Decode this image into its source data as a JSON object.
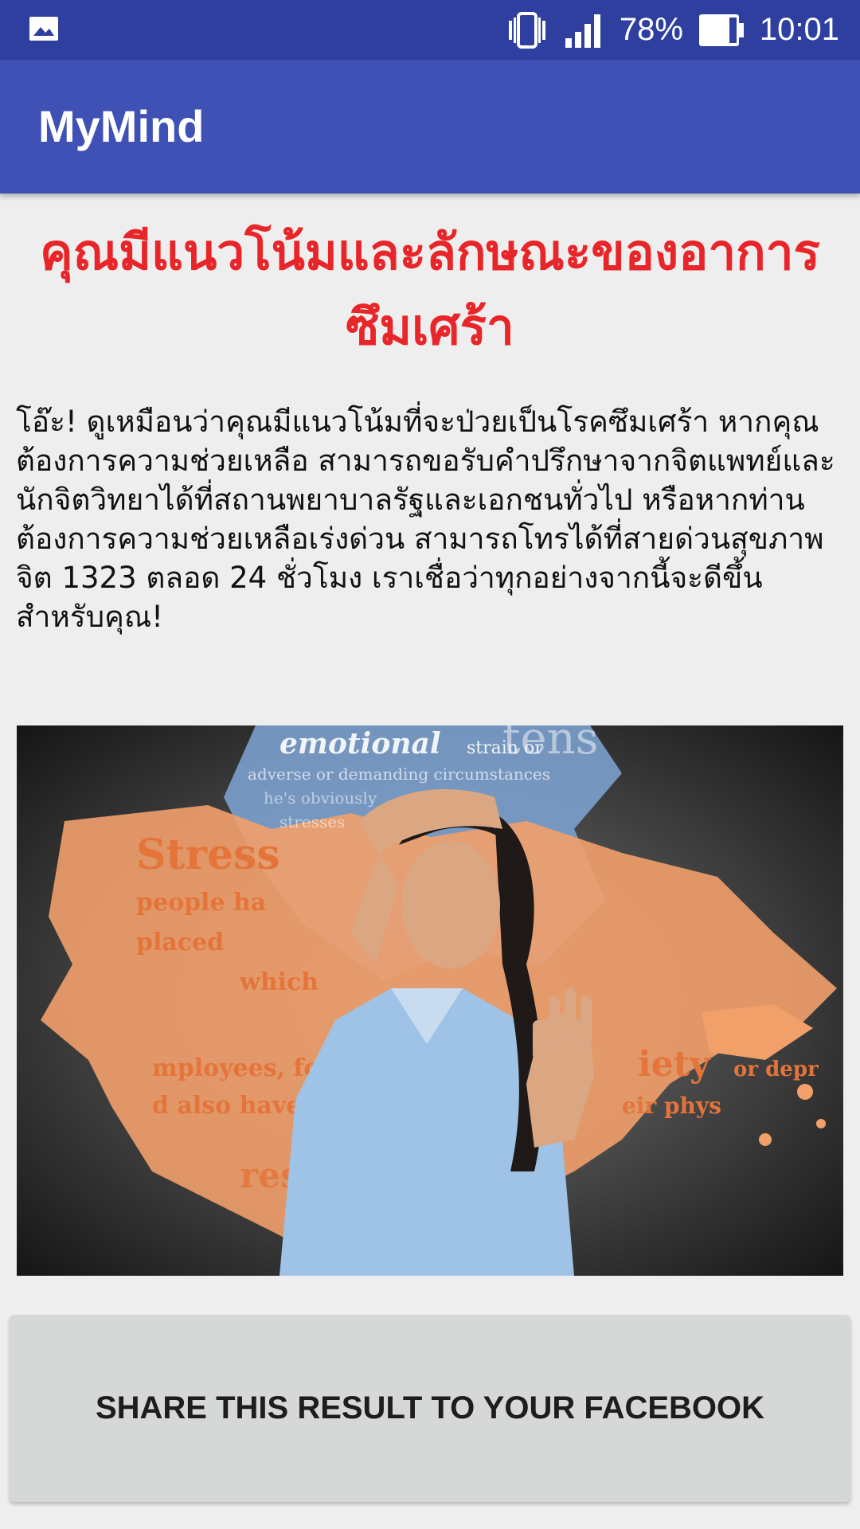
{
  "status_bar": {
    "battery_percent": "78%",
    "time": "10:01",
    "icons": [
      "picture-notification-icon",
      "vibrate-icon",
      "signal-icon",
      "battery-icon"
    ],
    "background_color": "#2f3f9f"
  },
  "app_bar": {
    "title": "MyMind",
    "background_color": "#3f51b5"
  },
  "result": {
    "headline": "คุณมีแนวโน้มและลักษณะของอาการซึมเศร้า",
    "headline_color": "#e8262a",
    "message": "โอ๊ะ! ดูเหมือนว่าคุณมีแนวโน้มที่จะป่วยเป็นโรคซึมเศร้า หากคุณต้องการความช่วยเหลือ สามารถขอรับคำปรึกษาจากจิตแพทย์และนักจิตวิทยาได้ที่สถานพยาบาลรัฐและเอกชนทั่วไป หรือหากท่านต้องการความช่วยเหลือเร่งด่วน สามารถโทรได้ที่สายด่วนสุขภาพจิต 1323 ตลอด 24 ชั่วโมง เราเชื่อว่าทุกอย่างจากนี้จะดีขึ้นสำหรับคุณ!"
  },
  "image": {
    "words": {
      "emotional": "emotional",
      "strain": "strain or",
      "tens": "tens",
      "adverse": "adverse or demanding circumstances",
      "obviously": "he's obviously",
      "stresses": "stresses",
      "stress": "Stress",
      "people": "people ha",
      "placed": "placed",
      "which": "which",
      "employees": "mployees, for",
      "also": "d also have",
      "iety": "iety",
      "depr": "or depr",
      "phys": "eir phys",
      "stress2": "ress"
    }
  },
  "share_button": {
    "label": "SHARE THIS RESULT TO YOUR FACEBOOK"
  }
}
